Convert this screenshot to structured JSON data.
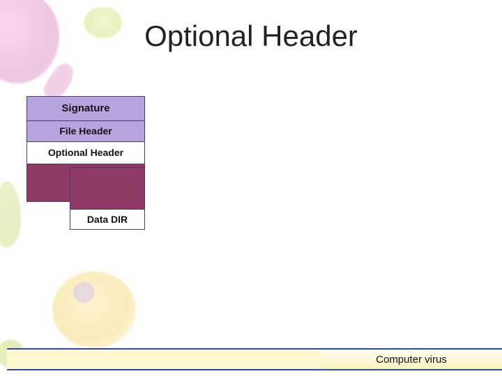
{
  "slide": {
    "title": "Optional Header"
  },
  "diagram": {
    "signature": "Signature",
    "file_header": "File Header",
    "optional_header": "Optional Header",
    "data_dir": "Data DIR"
  },
  "footer": {
    "label": "Computer virus"
  },
  "theme": {
    "accent_purple": "#b7a3de",
    "accent_maroon": "#8f3a64",
    "footer_yellow": "#fef7cf",
    "frame_blue": "#2b4aa0"
  }
}
